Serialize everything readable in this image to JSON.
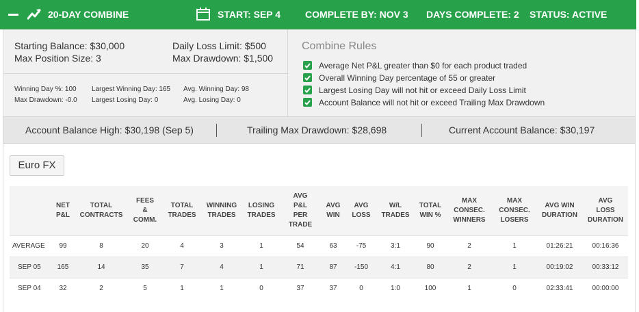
{
  "header": {
    "title": "20-DAY COMBINE",
    "start": "START: SEP 4",
    "complete_by": "COMPLETE BY: NOV 3",
    "days_complete": "DAYS COMPLETE: 2",
    "status": "STATUS: ACTIVE"
  },
  "summary": {
    "starting_balance": "Starting Balance: $30,000",
    "max_position_size": "Max Position Size: 3",
    "daily_loss_limit": "Daily Loss Limit: $500",
    "max_drawdown": "Max Drawdown: $1,500",
    "winning_day_pct": "Winning Day %: 100",
    "max_drawdown_stat": "Max Drawdown: -0.0",
    "largest_winning_day": "Largest Winning Day: 165",
    "largest_losing_day": "Largest Losing Day: 0",
    "avg_winning_day": "Avg. Winning Day: 98",
    "avg_losing_day": "Avg. Losing Day: 0"
  },
  "rules": {
    "title": "Combine Rules",
    "items": [
      "Average Net P&L greater than $0 for each product traded",
      "Overall Winning Day percentage of 55 or greater",
      "Largest Losing Day will not hit or exceed Daily Loss Limit",
      "Account Balance will not hit or exceed Trailing Max Drawdown"
    ]
  },
  "balances": {
    "high": "Account Balance High: $30,198 (Sep 5)",
    "trailing": "Trailing Max Drawdown: $28,698",
    "current": "Current Account Balance: $30,197"
  },
  "product_tab": "Euro FX",
  "table": {
    "headers": [
      "",
      "NET\nP&L",
      "TOTAL\nCONTRACTS",
      "FEES\n&\nCOMM.",
      "TOTAL\nTRADES",
      "WINNING\nTRADES",
      "LOSING\nTRADES",
      "AVG\nP&L\nPER\nTRADE",
      "AVG\nWIN",
      "AVG\nLOSS",
      "W/L\nTRADES",
      "TOTAL\nWIN %",
      "MAX\nCONSEC.\nWINNERS",
      "MAX\nCONSEC.\nLOSERS",
      "AVG WIN\nDURATION",
      "AVG\nLOSS\nDURATION"
    ],
    "rows": [
      [
        "AVERAGE",
        "99",
        "8",
        "20",
        "4",
        "3",
        "1",
        "54",
        "63",
        "-75",
        "3:1",
        "90",
        "2",
        "1",
        "01:26:21",
        "00:16:36"
      ],
      [
        "SEP 05",
        "165",
        "14",
        "35",
        "7",
        "4",
        "1",
        "71",
        "87",
        "-150",
        "4:1",
        "80",
        "2",
        "1",
        "00:19:02",
        "00:33:12"
      ],
      [
        "SEP 04",
        "32",
        "2",
        "5",
        "1",
        "1",
        "0",
        "37",
        "37",
        "0",
        "1:0",
        "100",
        "1",
        "0",
        "02:33:41",
        "00:00:00"
      ]
    ]
  }
}
